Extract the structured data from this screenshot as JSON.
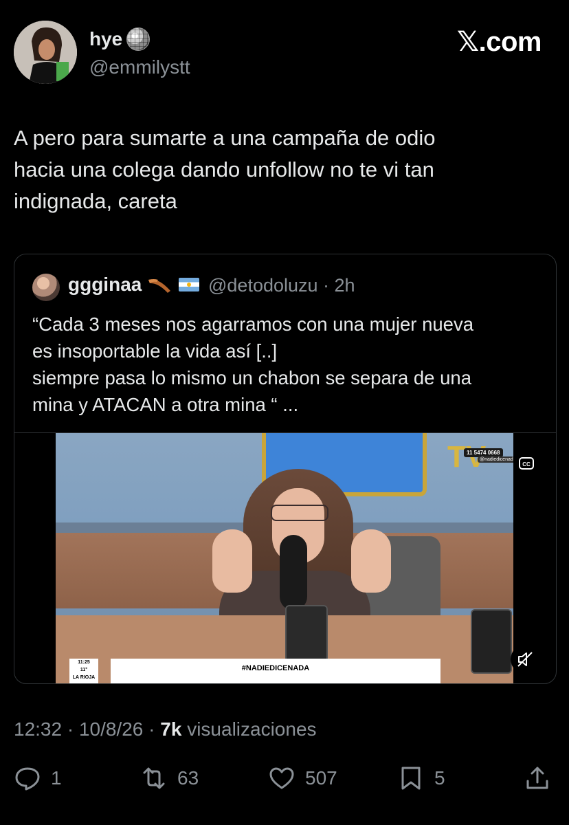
{
  "author": {
    "name": "hye",
    "handle": "@emmilystt",
    "badge_icon": "disco-ball-icon"
  },
  "brand": "𝕏.com",
  "tweet": {
    "text_lines": [
      "A pero para sumarte a una campaña de odio",
      "hacia una colega dando unfollow no te vi tan",
      "indignada, careta"
    ]
  },
  "quote": {
    "name": "ggginaa",
    "emoji": [
      "boomerang-icon",
      "argentina-flag-icon"
    ],
    "handle": "@detodoluzu",
    "time": "· 2h",
    "text_lines": [
      "“Cada 3 meses nos agarramos con una mujer nueva",
      "es insoportable la vida así [..]",
      "siempre pasa lo mismo un chabon se separa de una",
      "mina y ATACAN a otra mina “ ..."
    ],
    "video": {
      "lower_third": "#NADIEDICENADA",
      "tv_logo": "TV",
      "tv_phone": "11 5474 0668",
      "tv_handle": "@nadiedicenada",
      "weather_time": "11:25",
      "weather_temp": "11°",
      "weather_city": "LA RIOJA",
      "cc_label": "CC"
    }
  },
  "meta": {
    "time": "12:32 · 10/8/26 ·",
    "views_count": "7k",
    "views_label": "visualizaciones"
  },
  "actions": {
    "replies": "1",
    "reposts": "63",
    "likes": "507",
    "bookmarks": "5"
  },
  "colors": {
    "background": "#000000",
    "text": "#e7e9ea",
    "muted": "#8b9197",
    "border": "#2f3336"
  }
}
